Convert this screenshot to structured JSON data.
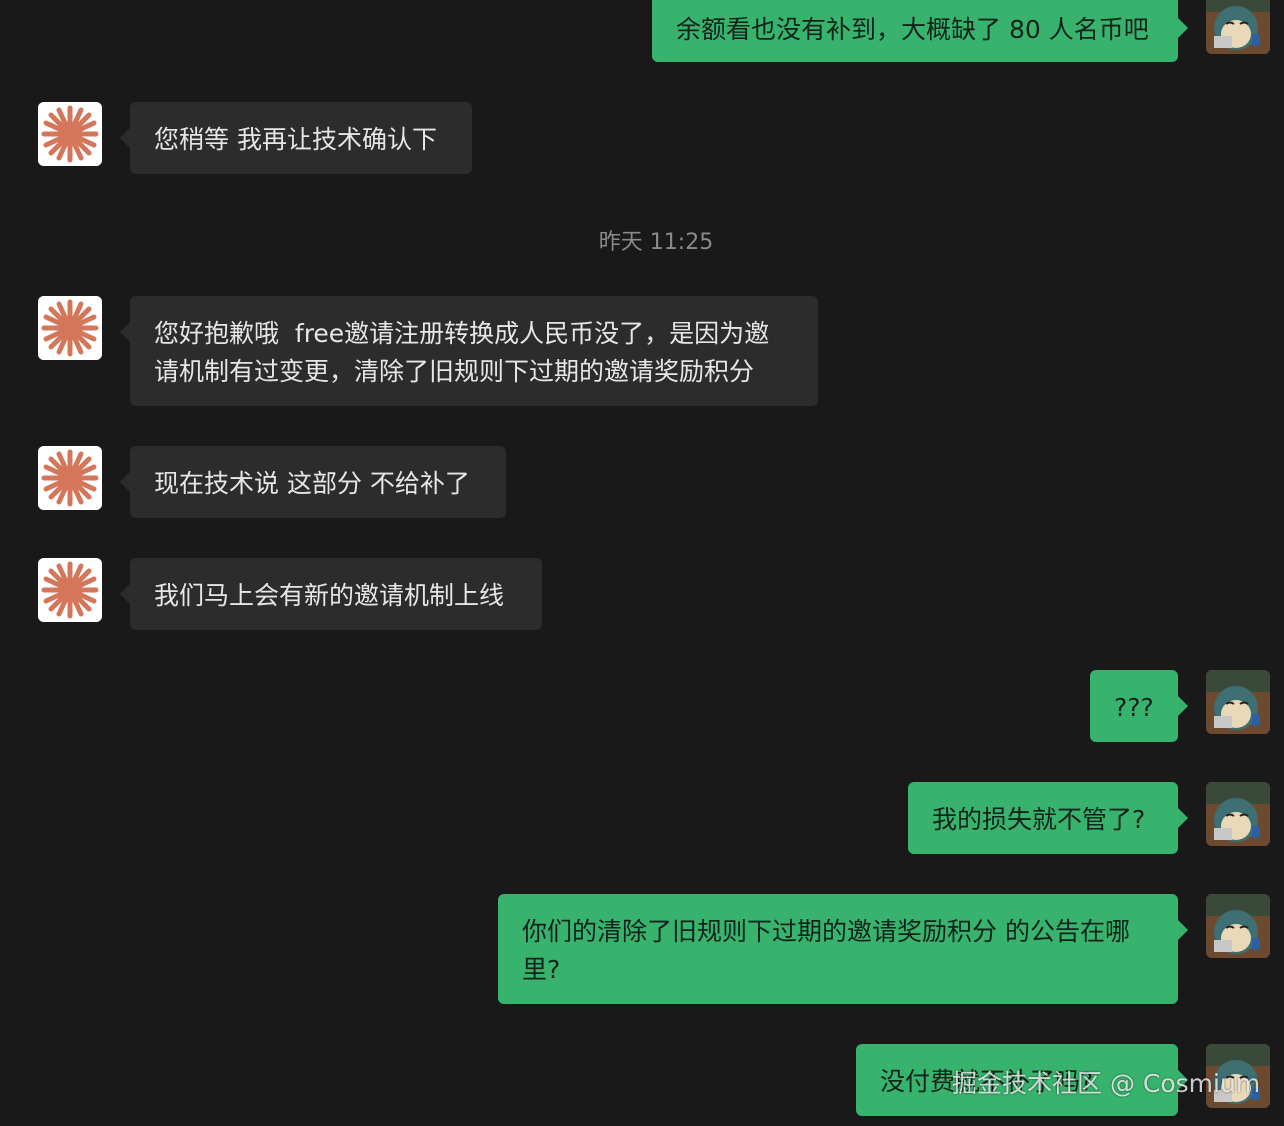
{
  "timestamp": "昨天 11:25",
  "messages": [
    {
      "text": "余额看也没有补到，大概缺了 80 人名币吧"
    },
    {
      "text": "您稍等 我再让技术确认下"
    },
    {
      "text": "您好抱歉哦  free邀请注册转换成人民币没了，是因为邀\n请机制有过变更，清除了旧规则下过期的邀请奖励积分"
    },
    {
      "text": "现在技术说 这部分 不给补了"
    },
    {
      "text": "我们马上会有新的邀请机制上线"
    },
    {
      "text": "???"
    },
    {
      "text": "我的损失就不管了?"
    },
    {
      "text": "你们的清除了旧规则下过期的邀请奖励积分 的公告在哪\n里?"
    },
    {
      "text": "没付费就不补了吗?"
    }
  ],
  "watermark": "掘金技术社区 @ Cosmium",
  "avatars": {
    "agent": "asterisk-logo-icon",
    "user": "snorlax-avatar-icon"
  },
  "colors": {
    "background": "#191919",
    "incoming_bubble": "#2c2c2c",
    "outgoing_bubble": "#38b36d",
    "agent_logo": "#d4765a"
  }
}
